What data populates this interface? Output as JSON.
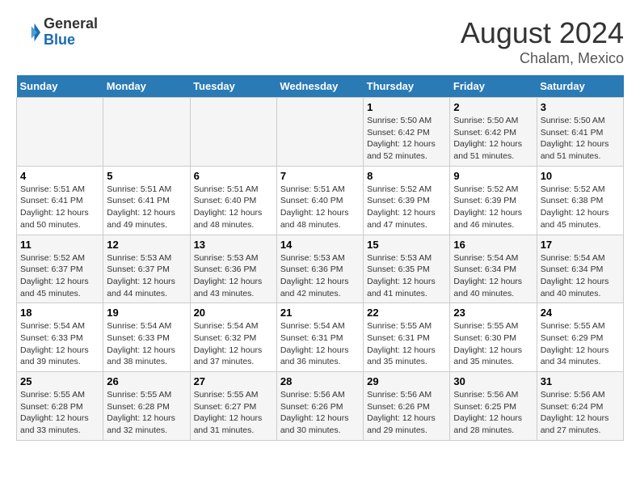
{
  "header": {
    "logo_general": "General",
    "logo_blue": "Blue",
    "title": "August 2024",
    "subtitle": "Chalam, Mexico"
  },
  "days_of_week": [
    "Sunday",
    "Monday",
    "Tuesday",
    "Wednesday",
    "Thursday",
    "Friday",
    "Saturday"
  ],
  "weeks": [
    [
      {
        "day": "",
        "info": ""
      },
      {
        "day": "",
        "info": ""
      },
      {
        "day": "",
        "info": ""
      },
      {
        "day": "",
        "info": ""
      },
      {
        "day": "1",
        "info": "Sunrise: 5:50 AM\nSunset: 6:42 PM\nDaylight: 12 hours and 52 minutes."
      },
      {
        "day": "2",
        "info": "Sunrise: 5:50 AM\nSunset: 6:42 PM\nDaylight: 12 hours and 51 minutes."
      },
      {
        "day": "3",
        "info": "Sunrise: 5:50 AM\nSunset: 6:41 PM\nDaylight: 12 hours and 51 minutes."
      }
    ],
    [
      {
        "day": "4",
        "info": "Sunrise: 5:51 AM\nSunset: 6:41 PM\nDaylight: 12 hours and 50 minutes."
      },
      {
        "day": "5",
        "info": "Sunrise: 5:51 AM\nSunset: 6:41 PM\nDaylight: 12 hours and 49 minutes."
      },
      {
        "day": "6",
        "info": "Sunrise: 5:51 AM\nSunset: 6:40 PM\nDaylight: 12 hours and 48 minutes."
      },
      {
        "day": "7",
        "info": "Sunrise: 5:51 AM\nSunset: 6:40 PM\nDaylight: 12 hours and 48 minutes."
      },
      {
        "day": "8",
        "info": "Sunrise: 5:52 AM\nSunset: 6:39 PM\nDaylight: 12 hours and 47 minutes."
      },
      {
        "day": "9",
        "info": "Sunrise: 5:52 AM\nSunset: 6:39 PM\nDaylight: 12 hours and 46 minutes."
      },
      {
        "day": "10",
        "info": "Sunrise: 5:52 AM\nSunset: 6:38 PM\nDaylight: 12 hours and 45 minutes."
      }
    ],
    [
      {
        "day": "11",
        "info": "Sunrise: 5:52 AM\nSunset: 6:37 PM\nDaylight: 12 hours and 45 minutes."
      },
      {
        "day": "12",
        "info": "Sunrise: 5:53 AM\nSunset: 6:37 PM\nDaylight: 12 hours and 44 minutes."
      },
      {
        "day": "13",
        "info": "Sunrise: 5:53 AM\nSunset: 6:36 PM\nDaylight: 12 hours and 43 minutes."
      },
      {
        "day": "14",
        "info": "Sunrise: 5:53 AM\nSunset: 6:36 PM\nDaylight: 12 hours and 42 minutes."
      },
      {
        "day": "15",
        "info": "Sunrise: 5:53 AM\nSunset: 6:35 PM\nDaylight: 12 hours and 41 minutes."
      },
      {
        "day": "16",
        "info": "Sunrise: 5:54 AM\nSunset: 6:34 PM\nDaylight: 12 hours and 40 minutes."
      },
      {
        "day": "17",
        "info": "Sunrise: 5:54 AM\nSunset: 6:34 PM\nDaylight: 12 hours and 40 minutes."
      }
    ],
    [
      {
        "day": "18",
        "info": "Sunrise: 5:54 AM\nSunset: 6:33 PM\nDaylight: 12 hours and 39 minutes."
      },
      {
        "day": "19",
        "info": "Sunrise: 5:54 AM\nSunset: 6:33 PM\nDaylight: 12 hours and 38 minutes."
      },
      {
        "day": "20",
        "info": "Sunrise: 5:54 AM\nSunset: 6:32 PM\nDaylight: 12 hours and 37 minutes."
      },
      {
        "day": "21",
        "info": "Sunrise: 5:54 AM\nSunset: 6:31 PM\nDaylight: 12 hours and 36 minutes."
      },
      {
        "day": "22",
        "info": "Sunrise: 5:55 AM\nSunset: 6:31 PM\nDaylight: 12 hours and 35 minutes."
      },
      {
        "day": "23",
        "info": "Sunrise: 5:55 AM\nSunset: 6:30 PM\nDaylight: 12 hours and 35 minutes."
      },
      {
        "day": "24",
        "info": "Sunrise: 5:55 AM\nSunset: 6:29 PM\nDaylight: 12 hours and 34 minutes."
      }
    ],
    [
      {
        "day": "25",
        "info": "Sunrise: 5:55 AM\nSunset: 6:28 PM\nDaylight: 12 hours and 33 minutes."
      },
      {
        "day": "26",
        "info": "Sunrise: 5:55 AM\nSunset: 6:28 PM\nDaylight: 12 hours and 32 minutes."
      },
      {
        "day": "27",
        "info": "Sunrise: 5:55 AM\nSunset: 6:27 PM\nDaylight: 12 hours and 31 minutes."
      },
      {
        "day": "28",
        "info": "Sunrise: 5:56 AM\nSunset: 6:26 PM\nDaylight: 12 hours and 30 minutes."
      },
      {
        "day": "29",
        "info": "Sunrise: 5:56 AM\nSunset: 6:26 PM\nDaylight: 12 hours and 29 minutes."
      },
      {
        "day": "30",
        "info": "Sunrise: 5:56 AM\nSunset: 6:25 PM\nDaylight: 12 hours and 28 minutes."
      },
      {
        "day": "31",
        "info": "Sunrise: 5:56 AM\nSunset: 6:24 PM\nDaylight: 12 hours and 27 minutes."
      }
    ]
  ]
}
